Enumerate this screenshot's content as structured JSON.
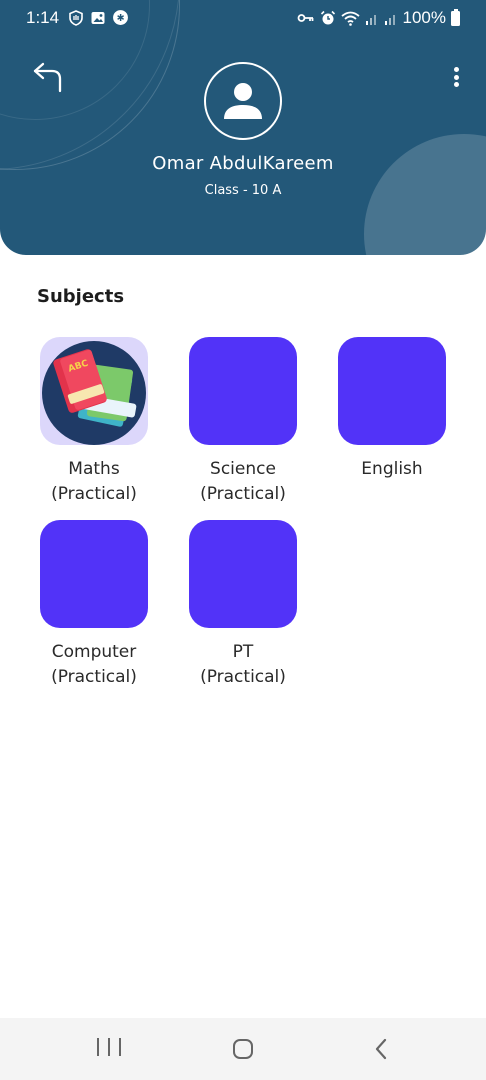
{
  "status_bar": {
    "time": "1:14",
    "battery_percent": "100%"
  },
  "header": {
    "student_name": "Omar AbdulKareem",
    "student_class": "Class - 10 A",
    "color": "#235879"
  },
  "subjects_section": {
    "title": "Subjects",
    "items": [
      {
        "label": "Maths\n(Practical)",
        "icon": "books-image"
      },
      {
        "label": "Science\n(Practical)",
        "icon": "blank-tile"
      },
      {
        "label": "English",
        "icon": "blank-tile"
      },
      {
        "label": "Computer\n(Practical)",
        "icon": "blank-tile"
      },
      {
        "label": "PT\n(Practical)",
        "icon": "blank-tile"
      }
    ],
    "tile_color": "#5233f8"
  }
}
